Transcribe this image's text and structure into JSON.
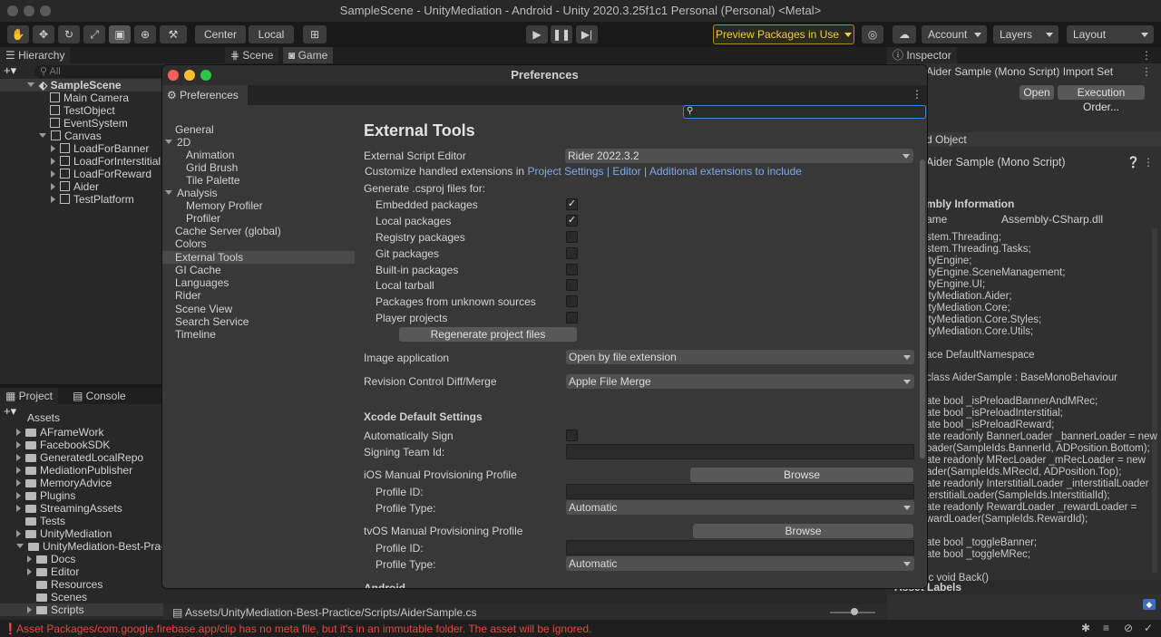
{
  "window_title": "SampleScene - UnityMediation - Android - Unity 2020.3.25f1c1 Personal (Personal) <Metal>",
  "toolbar": {
    "center_label": "Center",
    "local_label": "Local",
    "preview_packages_label": "Preview Packages in Use",
    "account_label": "Account",
    "layers_label": "Layers",
    "layout_label": "Layout"
  },
  "hierarchy": {
    "tab_label": "Hierarchy",
    "search_placeholder": "All",
    "items": [
      "SampleScene",
      "Main Camera",
      "TestObject",
      "EventSystem",
      "Canvas",
      "LoadForBanner",
      "LoadForInterstitial",
      "LoadForReward",
      "Aider",
      "TestPlatform"
    ]
  },
  "scene_tabs": {
    "scene": "Scene",
    "game": "Game"
  },
  "project": {
    "tab_label": "Project",
    "console_label": "Console",
    "items": [
      "Assets",
      "AFrameWork",
      "FacebookSDK",
      "GeneratedLocalRepo",
      "MediationPublisher",
      "MemoryAdvice",
      "Plugins",
      "StreamingAssets",
      "Tests",
      "UnityMediation",
      "UnityMediation-Best-Prac",
      "Docs",
      "Editor",
      "Resources",
      "Scenes",
      "Scripts"
    ],
    "path": "Assets/UnityMediation-Best-Practice/Scripts/AiderSample.cs"
  },
  "status_bar": {
    "message": "Asset Packages/com.google.firebase.app/clip has no meta file, but it's in an immutable folder. The asset will be ignored."
  },
  "preferences": {
    "window_title": "Preferences",
    "tab_label": "Preferences",
    "sidebar": [
      "General",
      "2D",
      "Animation",
      "Grid Brush",
      "Tile Palette",
      "Analysis",
      "Memory Profiler",
      "Profiler",
      "Cache Server (global)",
      "Colors",
      "External Tools",
      "GI Cache",
      "Languages",
      "Rider",
      "Scene View",
      "Search Service",
      "Timeline"
    ],
    "heading": "External Tools",
    "external_script_editor_label": "External Script Editor",
    "external_script_editor_value": "Rider 2022.3.2",
    "customize_prefix": "Customize handled extensions in",
    "project_settings_link": "Project Settings",
    "editor_link": "Editor",
    "additional_ext_link": "Additional extensions to include",
    "generate_label": "Generate .csproj files for:",
    "csproj_options": [
      {
        "label": "Embedded packages",
        "checked": true
      },
      {
        "label": "Local packages",
        "checked": true
      },
      {
        "label": "Registry packages",
        "checked": false
      },
      {
        "label": "Git packages",
        "checked": false
      },
      {
        "label": "Built-in packages",
        "checked": false
      },
      {
        "label": "Local tarball",
        "checked": false
      },
      {
        "label": "Packages from unknown sources",
        "checked": false
      },
      {
        "label": "Player projects",
        "checked": false
      }
    ],
    "regenerate_label": "Regenerate project files",
    "image_app_label": "Image application",
    "image_app_value": "Open by file extension",
    "revision_label": "Revision Control Diff/Merge",
    "revision_value": "Apple File Merge",
    "xcode_heading": "Xcode Default Settings",
    "auto_sign_label": "Automatically Sign",
    "signing_team_label": "Signing Team Id:",
    "ios_profile_label": "iOS Manual Provisioning Profile",
    "browse_label": "Browse",
    "profile_id_label": "Profile ID:",
    "profile_type_label": "Profile Type:",
    "profile_type_value": "Automatic",
    "tvos_profile_label": "tvOS Manual Provisioning Profile",
    "android_label": "Android"
  },
  "inspector": {
    "tab_label": "Inspector",
    "import_title": "Aider Sample (Mono Script) Import Set",
    "open_label": "Open",
    "exec_order_label": "Execution Order...",
    "object_label": "d Object",
    "script_title": "Aider Sample (Mono Script)",
    "assembly_heading": "mbly Information",
    "name_key": "ame",
    "name_value": "Assembly-CSharp.dll",
    "code_lines": [
      "stem.Threading;",
      "stem.Threading.Tasks;",
      "ityEngine;",
      "ityEngine.SceneManagement;",
      "ityEngine.UI;",
      "ityMediation.Aider;",
      "ityMediation.Core;",
      "ityMediation.Core.Styles;",
      "ityMediation.Core.Utils;",
      "",
      "ace DefaultNamespace",
      "",
      "class AiderSample : BaseMonoBehaviour",
      "",
      "ate bool _isPreloadBannerAndMRec;",
      "ate bool _isPreloadInterstitial;",
      "ate bool _isPreloadReward;",
      "ate readonly BannerLoader _bannerLoader = new",
      "oader(SampleIds.BannerId, ADPosition.Bottom);",
      "ate readonly MRecLoader _mRecLoader = new",
      "ader(SampleIds.MRecId, ADPosition.Top);",
      "ate readonly InterstitialLoader _interstitialLoader",
      "terstitialLoader(SampleIds.InterstitialId);",
      "ate readonly RewardLoader _rewardLoader =",
      "wardLoader(SampleIds.RewardId);",
      "",
      "ate bool _toggleBanner;",
      "ate bool _toggleMRec;",
      "",
      "ic void Back()"
    ],
    "asset_labels": "Asset Labels"
  }
}
